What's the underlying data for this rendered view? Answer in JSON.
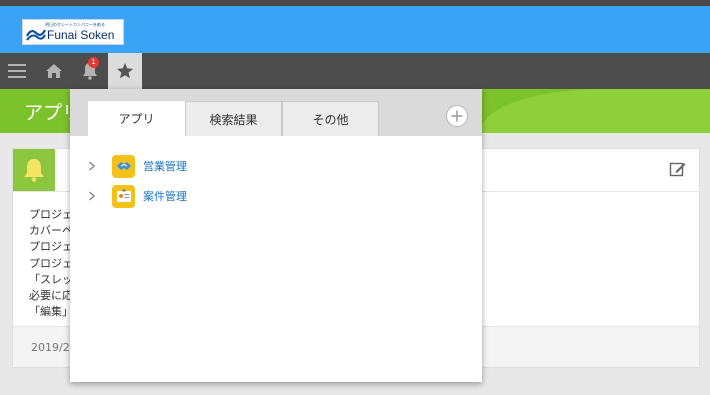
{
  "header": {
    "logo_text": "Funai Soken",
    "logo_tagline": "明日のグレートカンパニーを創る"
  },
  "navbar": {
    "items": [
      {
        "name": "menu",
        "icon": "menu-icon"
      },
      {
        "name": "home",
        "icon": "home-icon"
      },
      {
        "name": "notifications",
        "icon": "bell-icon",
        "badge": "1"
      },
      {
        "name": "favorites",
        "icon": "star-icon",
        "active": true
      }
    ]
  },
  "banner": {
    "title": "アプリ"
  },
  "card": {
    "lines": [
      "プロジェ",
      "カバーペ",
      "プロジェ",
      "プロジェ",
      "「スレッ",
      "必要に応",
      "「編集」"
    ],
    "date": "2019/2"
  },
  "popup": {
    "tabs": [
      {
        "label": "アプリ",
        "active": true
      },
      {
        "label": "検索結果",
        "active": false
      },
      {
        "label": "その他",
        "active": false
      }
    ],
    "apps": [
      {
        "label": "営業管理",
        "icon": "handshake-icon"
      },
      {
        "label": "案件管理",
        "icon": "id-card-icon"
      }
    ]
  },
  "colors": {
    "header_bg": "#3ba3f5",
    "navbar_bg": "#4d4d4d",
    "banner_bg": "#7cc22a",
    "app_icon_bg": "#f2c21b",
    "link": "#1a73c7",
    "badge": "#e53935"
  }
}
